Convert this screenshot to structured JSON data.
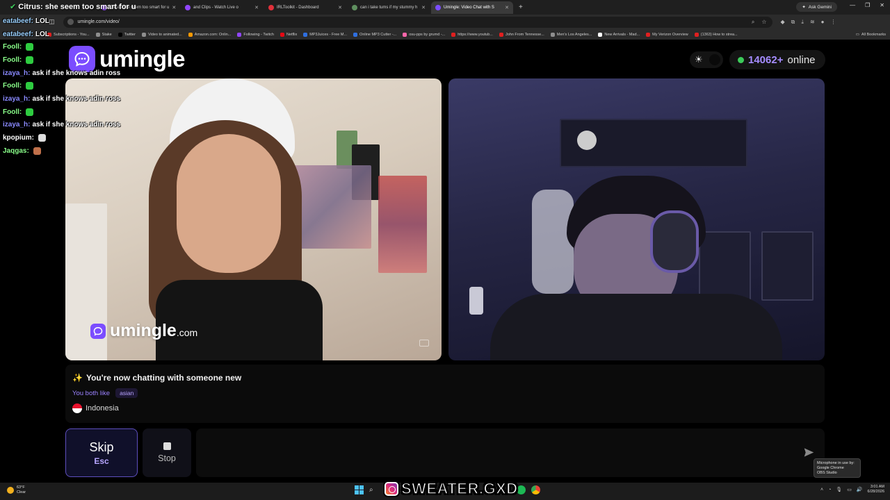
{
  "browser": {
    "tabs": [
      {
        "label": "Citrus: she seem too smart for u",
        "active": false,
        "color": "#9146ff"
      },
      {
        "label": "and Clips - Watch Live o",
        "active": false,
        "color": "#9146ff"
      },
      {
        "label": "IRLToolkit - Dashboard",
        "active": false,
        "color": "#e0303a"
      },
      {
        "label": "can i take tums if my stummy h",
        "active": false,
        "color": "#5f8f5f"
      },
      {
        "label": "Umingle: Video Chat with S",
        "active": true,
        "color": "#7b4dff"
      }
    ],
    "new_tab": "+",
    "ask_gemini": "Ask Gemini",
    "url": "umingle.com/video/",
    "bookmarks": [
      {
        "label": "Subscriptions - You...",
        "color": "#e02020"
      },
      {
        "label": "Stake",
        "color": "#8e8e8e"
      },
      {
        "label": "Twitter",
        "color": "#000000"
      },
      {
        "label": "Video to animated...",
        "color": "#8e8e8e"
      },
      {
        "label": "Amazon.com: Onlin...",
        "color": "#ff9900"
      },
      {
        "label": "Following - Twitch",
        "color": "#9146ff"
      },
      {
        "label": "Netflix",
        "color": "#e50914"
      },
      {
        "label": "MP3Juices - Free M...",
        "color": "#2f6fe0"
      },
      {
        "label": "Online MP3 Cutter -...",
        "color": "#2f6fe0"
      },
      {
        "label": "osu-pps by grumd -...",
        "color": "#ff66aa"
      },
      {
        "label": "https://www.youtub...",
        "color": "#e02020"
      },
      {
        "label": "John From Tennesse...",
        "color": "#e02020"
      },
      {
        "label": "Men's Los Angeles...",
        "color": "#8e8e8e"
      },
      {
        "label": "New Arrivals - Mad...",
        "color": "#ffffff"
      },
      {
        "label": "My Verizon Overview",
        "color": "#e02020"
      },
      {
        "label": "(1363) How to strea...",
        "color": "#e02020"
      }
    ],
    "all_bookmarks": "All Bookmarks"
  },
  "site": {
    "logo_text": "umingle",
    "online_count": "14062+",
    "online_label": "online",
    "watermark_main": "umingle",
    "watermark_suffix": ".com",
    "accent": "#7b4dff"
  },
  "info": {
    "sparkle": "✨",
    "title": "You're now chatting with someone new",
    "like_label": "You both like",
    "tag": "asian",
    "country": "Indonesia"
  },
  "controls": {
    "skip_label": "Skip",
    "skip_key": "Esc",
    "stop_label": "Stop",
    "chat_placeholder": ""
  },
  "overlay": {
    "title": "Citrus: she seem too smart for u",
    "chat": [
      {
        "user": "eatabeef:",
        "msg": "LOL",
        "user_color": "#9ad0ff"
      },
      {
        "user": "eatabeef:",
        "msg": "LOL",
        "user_color": "#9ad0ff"
      },
      {
        "user": "Fooll:",
        "msg": "",
        "user_color": "#8aff8a",
        "emote": "#2ecc40"
      },
      {
        "user": "Fooll:",
        "msg": "",
        "user_color": "#8aff8a",
        "emote": "#2ecc40"
      },
      {
        "user": "izaya_h:",
        "msg": "ask if she knows adin ross",
        "user_color": "#8a8aff"
      },
      {
        "user": "Fooll:",
        "msg": "",
        "user_color": "#8aff8a",
        "emote": "#2ecc40"
      },
      {
        "user": "izaya_h:",
        "msg": "ask if she knows adin ross",
        "user_color": "#8a8aff"
      },
      {
        "user": "Fooll:",
        "msg": "",
        "user_color": "#8aff8a",
        "emote": "#2ecc40"
      },
      {
        "user": "izaya_h:",
        "msg": "ask if she knows adin ross",
        "user_color": "#8a8aff"
      },
      {
        "user": "kpopium:",
        "msg": "",
        "user_color": "#ffffff",
        "emote": "#dddddd"
      },
      {
        "user": "Jaqgas:",
        "msg": "",
        "user_color": "#8aff8a",
        "emote": "#c0704a"
      }
    ]
  },
  "tooltip": {
    "line1": "Microphone in use by:",
    "line2": "Google Chrome",
    "line3": "OBS Studio"
  },
  "taskbar": {
    "temp": "63°F",
    "condition": "Clear",
    "instagram_handle": "SWEATER.GXD",
    "time": "3:01 AM",
    "date": "6/28/2026"
  }
}
